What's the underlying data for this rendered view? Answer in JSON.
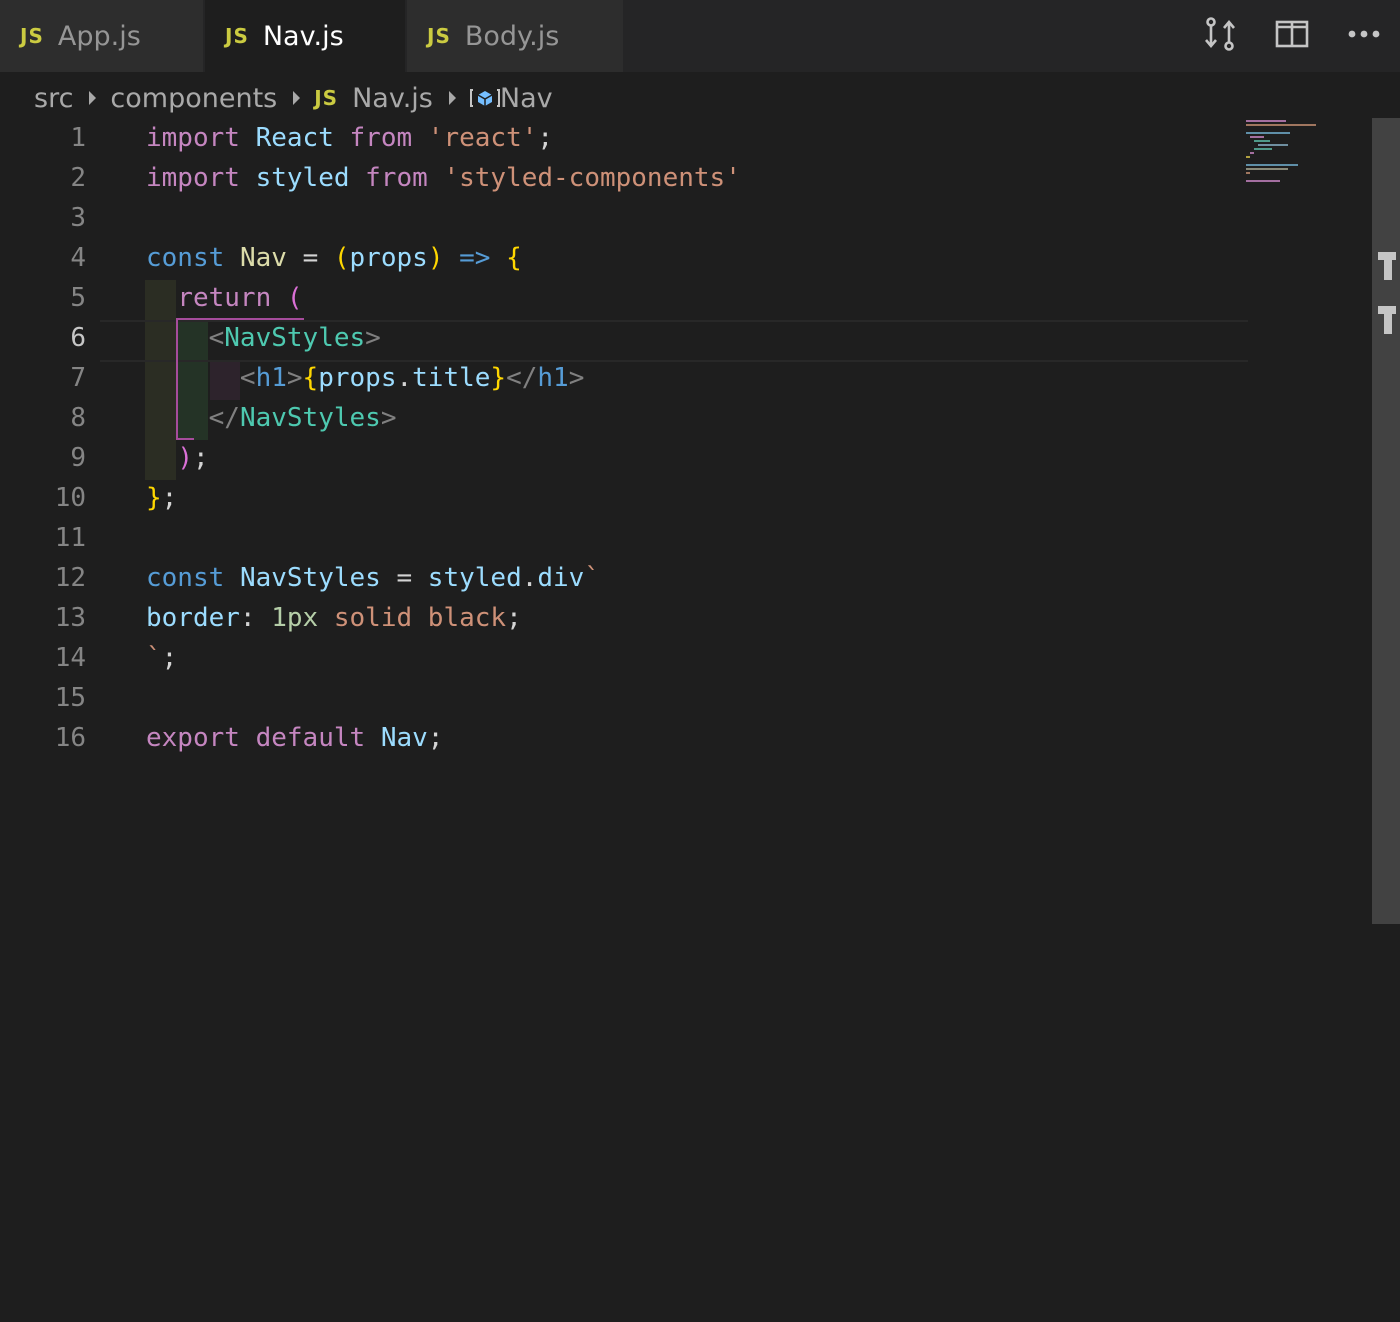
{
  "tabs": [
    {
      "badge": "JS",
      "label": "App.js",
      "active": false
    },
    {
      "badge": "JS",
      "label": "Nav.js",
      "active": true
    },
    {
      "badge": "JS",
      "label": "Body.js",
      "active": false
    }
  ],
  "editor_actions": [
    {
      "icon": "source-control-compare-icon"
    },
    {
      "icon": "split-editor-icon"
    },
    {
      "icon": "more-actions-icon"
    }
  ],
  "breadcrumb": {
    "items": [
      "src",
      "components",
      "Nav.js",
      "Nav"
    ],
    "file_badge": "JS",
    "symbol_icon": "symbol-variable-icon"
  },
  "editor": {
    "current_line": 6,
    "line_numbers": [
      "1",
      "2",
      "3",
      "4",
      "5",
      "6",
      "7",
      "8",
      "9",
      "10",
      "11",
      "12",
      "13",
      "14",
      "15",
      "16"
    ],
    "lines": [
      "import React from 'react';",
      "import styled from 'styled-components'",
      "",
      "const Nav = (props) => {",
      "  return (",
      "    <NavStyles>",
      "      <h1>{props.title}</h1>",
      "    </NavStyles>",
      "  );",
      "};",
      "",
      "const NavStyles = styled.div`",
      "border: 1px solid black;",
      "`;",
      "",
      "export default Nav;"
    ]
  },
  "colors": {
    "background": "#1e1e1e",
    "keyword": "#c586c0",
    "string": "#ce9178",
    "variable": "#9cdcfe",
    "component": "#4ec9b0",
    "js_badge": "#cbcb41"
  }
}
